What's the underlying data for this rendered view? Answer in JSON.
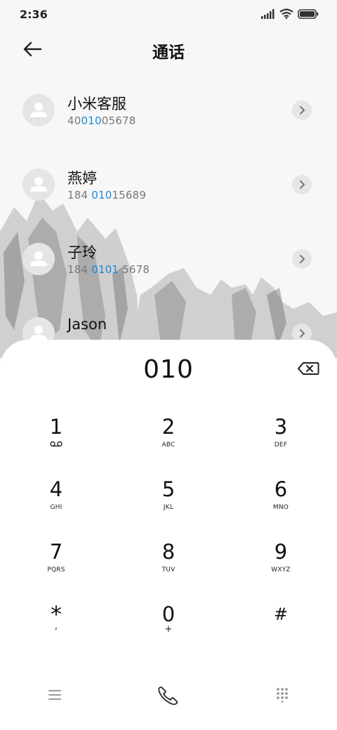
{
  "status": {
    "time": "2:36"
  },
  "header": {
    "title": "通话"
  },
  "contacts": [
    {
      "name": "小米客服",
      "num_pre": "40",
      "num_hl": "010",
      "num_post": "05678"
    },
    {
      "name": "燕婷",
      "num_pre": "184 ",
      "num_hl": "010",
      "num_post": "15689"
    },
    {
      "name": "子玲",
      "num_pre": "184 ",
      "num_hl": "0101",
      "num_post": " 5678"
    },
    {
      "name": "Jason",
      "num_pre": "",
      "num_hl": "",
      "num_post": ""
    }
  ],
  "dialer": {
    "number": "010",
    "keys": [
      {
        "digit": "1",
        "letters": ""
      },
      {
        "digit": "2",
        "letters": "ABC"
      },
      {
        "digit": "3",
        "letters": "DEF"
      },
      {
        "digit": "4",
        "letters": "GHI"
      },
      {
        "digit": "5",
        "letters": "JKL"
      },
      {
        "digit": "6",
        "letters": "MNO"
      },
      {
        "digit": "7",
        "letters": "PQRS"
      },
      {
        "digit": "8",
        "letters": "TUV"
      },
      {
        "digit": "9",
        "letters": "WXYZ"
      },
      {
        "digit": "*",
        "letters": ","
      },
      {
        "digit": "0",
        "letters": "+"
      },
      {
        "digit": "#",
        "letters": ""
      }
    ]
  },
  "icons": {
    "back": "arrow-left-icon",
    "backspace": "backspace-icon",
    "voicemail": "voicemail-icon",
    "menu": "menu-icon",
    "call": "phone-icon",
    "dialpad": "dialpad-icon"
  },
  "colors": {
    "highlight": "#1a8ad6",
    "panel": "#ffffff"
  }
}
